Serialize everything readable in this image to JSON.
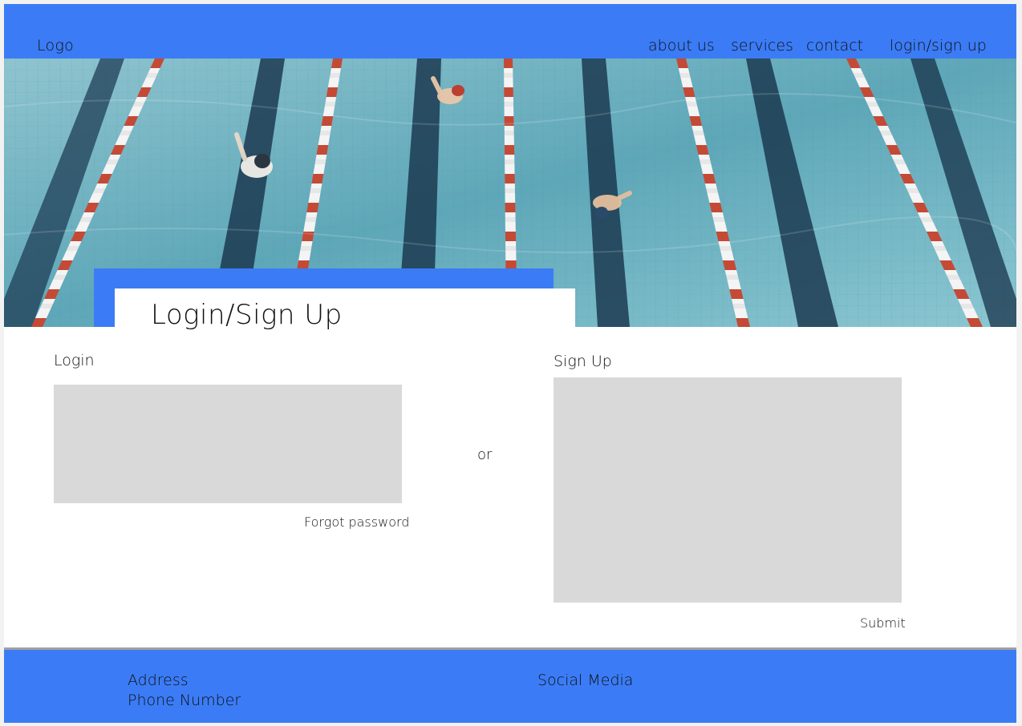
{
  "header": {
    "logo": "Logo",
    "nav": {
      "about": "about us",
      "services": "services",
      "contact": "contact",
      "login": "login/sign up"
    }
  },
  "hero": {
    "image_alt": "swimming pool with swimmers"
  },
  "page_title": "Login/Sign Up",
  "login": {
    "label": "Login",
    "forgot_password": "Forgot password"
  },
  "divider_text": "or",
  "signup": {
    "label": "Sign Up",
    "submit": "Submit"
  },
  "footer": {
    "address": "Address",
    "phone": "Phone Number",
    "social": "Social Media"
  },
  "colors": {
    "brand_blue": "#3b7cf6",
    "placeholder_gray": "#d9d9d9",
    "pool_water": "#6fb3c4"
  }
}
